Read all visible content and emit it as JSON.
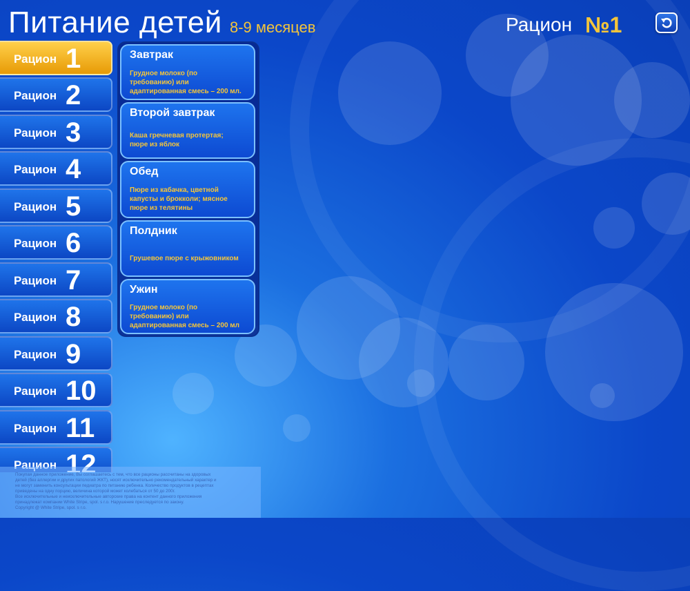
{
  "header": {
    "title": "Питание детей",
    "age": "8-9 месяцев",
    "ration_label": "Рацион",
    "ration_number": "№1"
  },
  "rations": [
    {
      "label": "Рацион",
      "number": "1",
      "active": true
    },
    {
      "label": "Рацион",
      "number": "2"
    },
    {
      "label": "Рацион",
      "number": "3"
    },
    {
      "label": "Рацион",
      "number": "4"
    },
    {
      "label": "Рацион",
      "number": "5"
    },
    {
      "label": "Рацион",
      "number": "6"
    },
    {
      "label": "Рацион",
      "number": "7"
    },
    {
      "label": "Рацион",
      "number": "8"
    },
    {
      "label": "Рацион",
      "number": "9"
    },
    {
      "label": "Рацион",
      "number": "10"
    },
    {
      "label": "Рацион",
      "number": "11"
    },
    {
      "label": "Рацион",
      "number": "12"
    }
  ],
  "meals": [
    {
      "title": "Завтрак",
      "lines": [
        "Грудное молоко (по",
        "требованию) или",
        "адаптированная смесь – 200 мл."
      ]
    },
    {
      "title": "Второй завтрак",
      "lines": [
        "Каша гречневая протертая;",
        "пюре из яблок"
      ]
    },
    {
      "title": "Обед",
      "lines": [
        "Пюре из кабачка, цветной",
        "капусты и брокколи; мясное",
        "пюре из телятины"
      ]
    },
    {
      "title": "Полдник",
      "lines": [
        "Грушевое пюре с крыжовником"
      ]
    },
    {
      "title": "Ужин",
      "lines": [
        "Грудное молоко (по",
        "требованию) или",
        "адаптированная смесь – 200 мл"
      ]
    }
  ],
  "disclaimer": [
    "Покупая данное приложение, Вы соглашаетесь с тем, что все рационы рассчитаны на здоровых",
    "детей (без аллергии и других патологий ЖКТ), носят исключительно рекомендательный характер и",
    "не могут заменить консультации педиатра по питанию ребенка. Количество продуктов в рецептах",
    "приведены на одну порцию, величина которой может колебаться от 50 до 200г.",
    "Все исключительные и неисключительные авторские права на контент данного приложения",
    "принадлежат компании White Stripe, spol. s r.o. Нарушение преследуется по закону.",
    "Copyright @ White Stripe, spol. s r.o."
  ],
  "icons": {
    "back": "return-arrow-icon"
  },
  "colors": {
    "accent_yellow": "#f4c53a",
    "active_tab": "#f0a812",
    "background_blue": "#0b47c9"
  }
}
